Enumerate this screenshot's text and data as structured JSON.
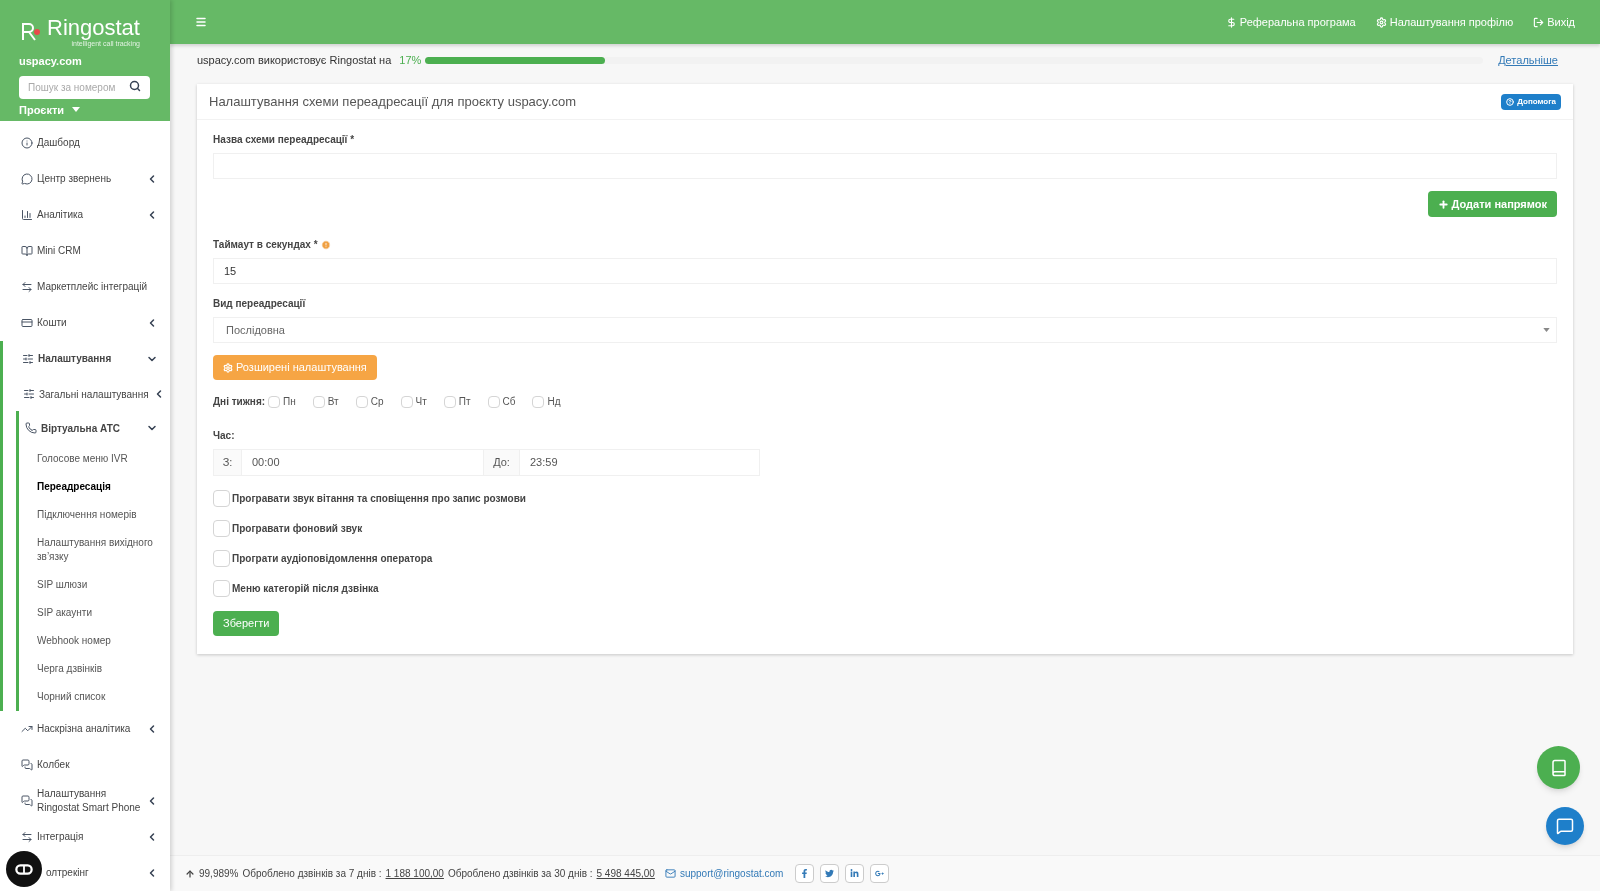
{
  "sidebar": {
    "brand": "Ringostat",
    "tagline": "intelligent call tracking",
    "project": "uspacy.com",
    "search": {
      "placeholder": "Пошук за номером"
    },
    "projects_menu": "Проєкти",
    "items": [
      {
        "kind": "link",
        "label": "Дашборд"
      },
      {
        "kind": "group",
        "label": "Центр звернень",
        "expanded": false
      },
      {
        "kind": "group",
        "label": "Аналітика",
        "expanded": false
      },
      {
        "kind": "link",
        "label": "Mini CRM"
      },
      {
        "kind": "link",
        "label": "Маркетплейс інтеграцій"
      },
      {
        "kind": "group",
        "label": "Кошти",
        "expanded": false
      },
      {
        "kind": "group",
        "label": "Налаштування",
        "expanded": true,
        "children": [
          {
            "kind": "group",
            "label": "Загальні налаштування",
            "expanded": false
          },
          {
            "kind": "group",
            "label": "Віртуальна АТС",
            "expanded": true,
            "children": [
              {
                "label": "Голосове меню IVR",
                "selected": false
              },
              {
                "label": "Переадресація",
                "selected": true
              },
              {
                "label": "Підключення номерів",
                "selected": false
              },
              {
                "label": "Налаштування вихідного зв’язку",
                "selected": false
              },
              {
                "label": "SIP шлюзи",
                "selected": false
              },
              {
                "label": "SIP акаунти",
                "selected": false
              },
              {
                "label": "Webhook номер",
                "selected": false
              },
              {
                "label": "Черга дзвінків",
                "selected": false
              },
              {
                "label": "Чорний список",
                "selected": false
              }
            ]
          }
        ]
      },
      {
        "kind": "group",
        "label": "Наскрізна аналітика",
        "expanded": false
      },
      {
        "kind": "link",
        "label": "Колбек"
      },
      {
        "kind": "group",
        "label": "Налаштування Ringostat Smart Phone",
        "expanded": false
      },
      {
        "kind": "group",
        "label": "Інтеграція",
        "expanded": false
      },
      {
        "kind": "group",
        "label": "олтрекінг",
        "expanded": false
      }
    ]
  },
  "topbar": {
    "links": [
      "Реферальна програма",
      "Налаштування профілю",
      "Вихід"
    ]
  },
  "usage": {
    "text": "uspacy.com використовує Ringostat на",
    "percent": "17%",
    "level": 0.17,
    "more_link": "Детальніше"
  },
  "card": {
    "title": "Налаштування схеми переадресації для проєкту uspacy.com",
    "help_button": "Допомога",
    "name_label": "Назва схеми переадресації *",
    "add_button": "Додати напрямок",
    "timeout_label": "Таймаут в секундах *",
    "timeout_value": "15",
    "type_label": "Вид переадресації",
    "type_value": "Послідовна",
    "advanced_button": "Розширені налаштування",
    "days_label": "Дні тижня:",
    "days": [
      {
        "label": "Пн",
        "checked": false
      },
      {
        "label": "Вт",
        "checked": false
      },
      {
        "label": "Ср",
        "checked": false
      },
      {
        "label": "Чт",
        "checked": false
      },
      {
        "label": "Пт",
        "checked": false
      },
      {
        "label": "Сб",
        "checked": false
      },
      {
        "label": "Нд",
        "checked": false
      }
    ],
    "time_label": "Час:",
    "from_label": "З:",
    "from_value": "00:00",
    "to_label": "До:",
    "to_value": "23:59",
    "options": [
      {
        "label": "Програвати звук вітання та сповіщення про запис розмови",
        "checked": false
      },
      {
        "label": "Програвати фоновий звук",
        "checked": false
      },
      {
        "label": "Програти аудіоповідомлення оператора",
        "checked": false
      },
      {
        "label": "Меню категорій після дзвінка",
        "checked": false
      }
    ],
    "save_button": "Зберегти"
  },
  "footer": {
    "uptime": "99,989%",
    "label_7": "Оброблено дзвінків за 7 днів :",
    "value_7": "1 188 100,00",
    "label_30": "Оброблено дзвінків за 30 днів :",
    "value_30": "5 498 445,00",
    "email": "support@ringostat.com"
  }
}
